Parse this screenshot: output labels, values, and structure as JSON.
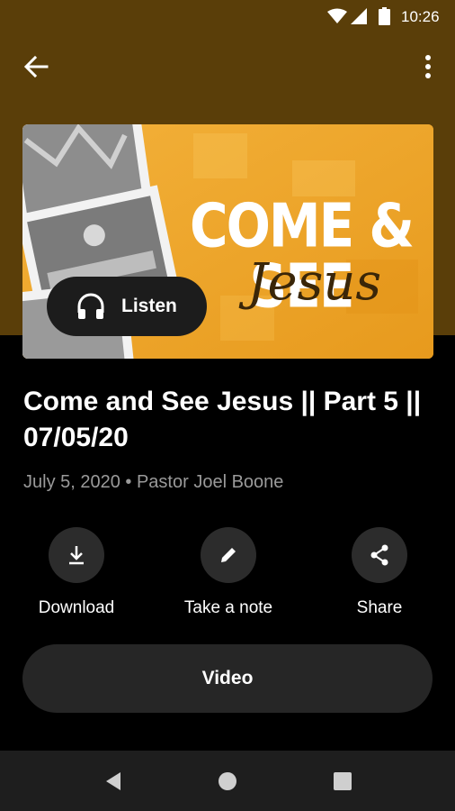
{
  "status_bar": {
    "time": "10:26",
    "icons": [
      "wifi-icon",
      "signal-icon",
      "battery-icon"
    ]
  },
  "toolbar": {
    "back_icon": "arrow-back-icon",
    "menu_icon": "more-vertical-icon"
  },
  "banner": {
    "title": "COME & SEE",
    "script": "Jesus",
    "accent": "#f0a324"
  },
  "listen": {
    "label": "Listen",
    "icon": "headphones-icon"
  },
  "sermon": {
    "title": "Come and See Jesus || Part 5 || 07/05/20",
    "meta": "July 5, 2020 • Pastor Joel Boone"
  },
  "actions": [
    {
      "label": "Download",
      "icon": "download-icon"
    },
    {
      "label": "Take a note",
      "icon": "pencil-icon"
    },
    {
      "label": "Share",
      "icon": "share-icon"
    }
  ],
  "video": {
    "label": "Video"
  },
  "nav": {
    "icons": [
      "back-triangle-icon",
      "home-circle-icon",
      "recents-square-icon"
    ]
  },
  "colors": {
    "header_bg": "#5a3e09",
    "background": "#000000",
    "button_bg": "#262626",
    "meta_text": "#9a9a9a"
  }
}
